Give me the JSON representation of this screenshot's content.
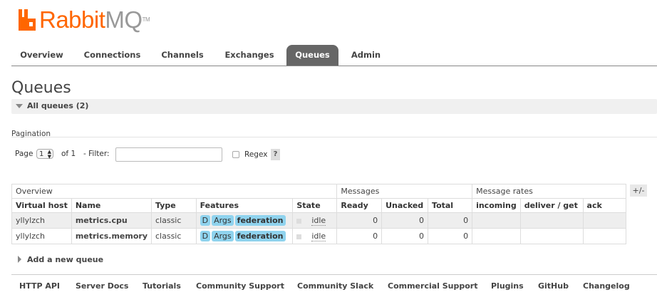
{
  "logo": {
    "rabbit": "Rabbit",
    "mq": "MQ",
    "tm": "TM",
    "brand_color": "#ff6600"
  },
  "tabs": [
    {
      "label": "Overview",
      "active": false
    },
    {
      "label": "Connections",
      "active": false
    },
    {
      "label": "Channels",
      "active": false
    },
    {
      "label": "Exchanges",
      "active": false
    },
    {
      "label": "Queues",
      "active": true
    },
    {
      "label": "Admin",
      "active": false
    }
  ],
  "page": {
    "title": "Queues",
    "section_label": "All queues (2)"
  },
  "pagination": {
    "heading": "Pagination",
    "page_label": "Page",
    "page_value": "1",
    "of_label": "of 1",
    "filter_label": "- Filter:",
    "filter_value": "",
    "regex_label": "Regex",
    "help_label": "?"
  },
  "table": {
    "groups": {
      "overview": "Overview",
      "messages": "Messages",
      "rates": "Message rates"
    },
    "headers": [
      "Virtual host",
      "Name",
      "Type",
      "Features",
      "State",
      "Ready",
      "Unacked",
      "Total",
      "incoming",
      "deliver / get",
      "ack"
    ],
    "rows": [
      {
        "vhost": "yllylzch",
        "name": "metrics.cpu",
        "type": "classic",
        "features": [
          "D",
          "Args",
          "federation"
        ],
        "state": "idle",
        "ready": "0",
        "unacked": "0",
        "total": "0",
        "incoming": "",
        "deliver_get": "",
        "ack": ""
      },
      {
        "vhost": "yllylzch",
        "name": "metrics.memory",
        "type": "classic",
        "features": [
          "D",
          "Args",
          "federation"
        ],
        "state": "idle",
        "ready": "0",
        "unacked": "0",
        "total": "0",
        "incoming": "",
        "deliver_get": "",
        "ack": ""
      }
    ],
    "columns_toggle": "+/-"
  },
  "add_queue": {
    "label": "Add a new queue"
  },
  "footer": [
    "HTTP API",
    "Server Docs",
    "Tutorials",
    "Community Support",
    "Community Slack",
    "Commercial Support",
    "Plugins",
    "GitHub",
    "Changelog"
  ],
  "colors": {
    "accent_tab": "#666666",
    "feature_pill": "#8fd3ee",
    "row_stripe": "#eeeeee"
  }
}
